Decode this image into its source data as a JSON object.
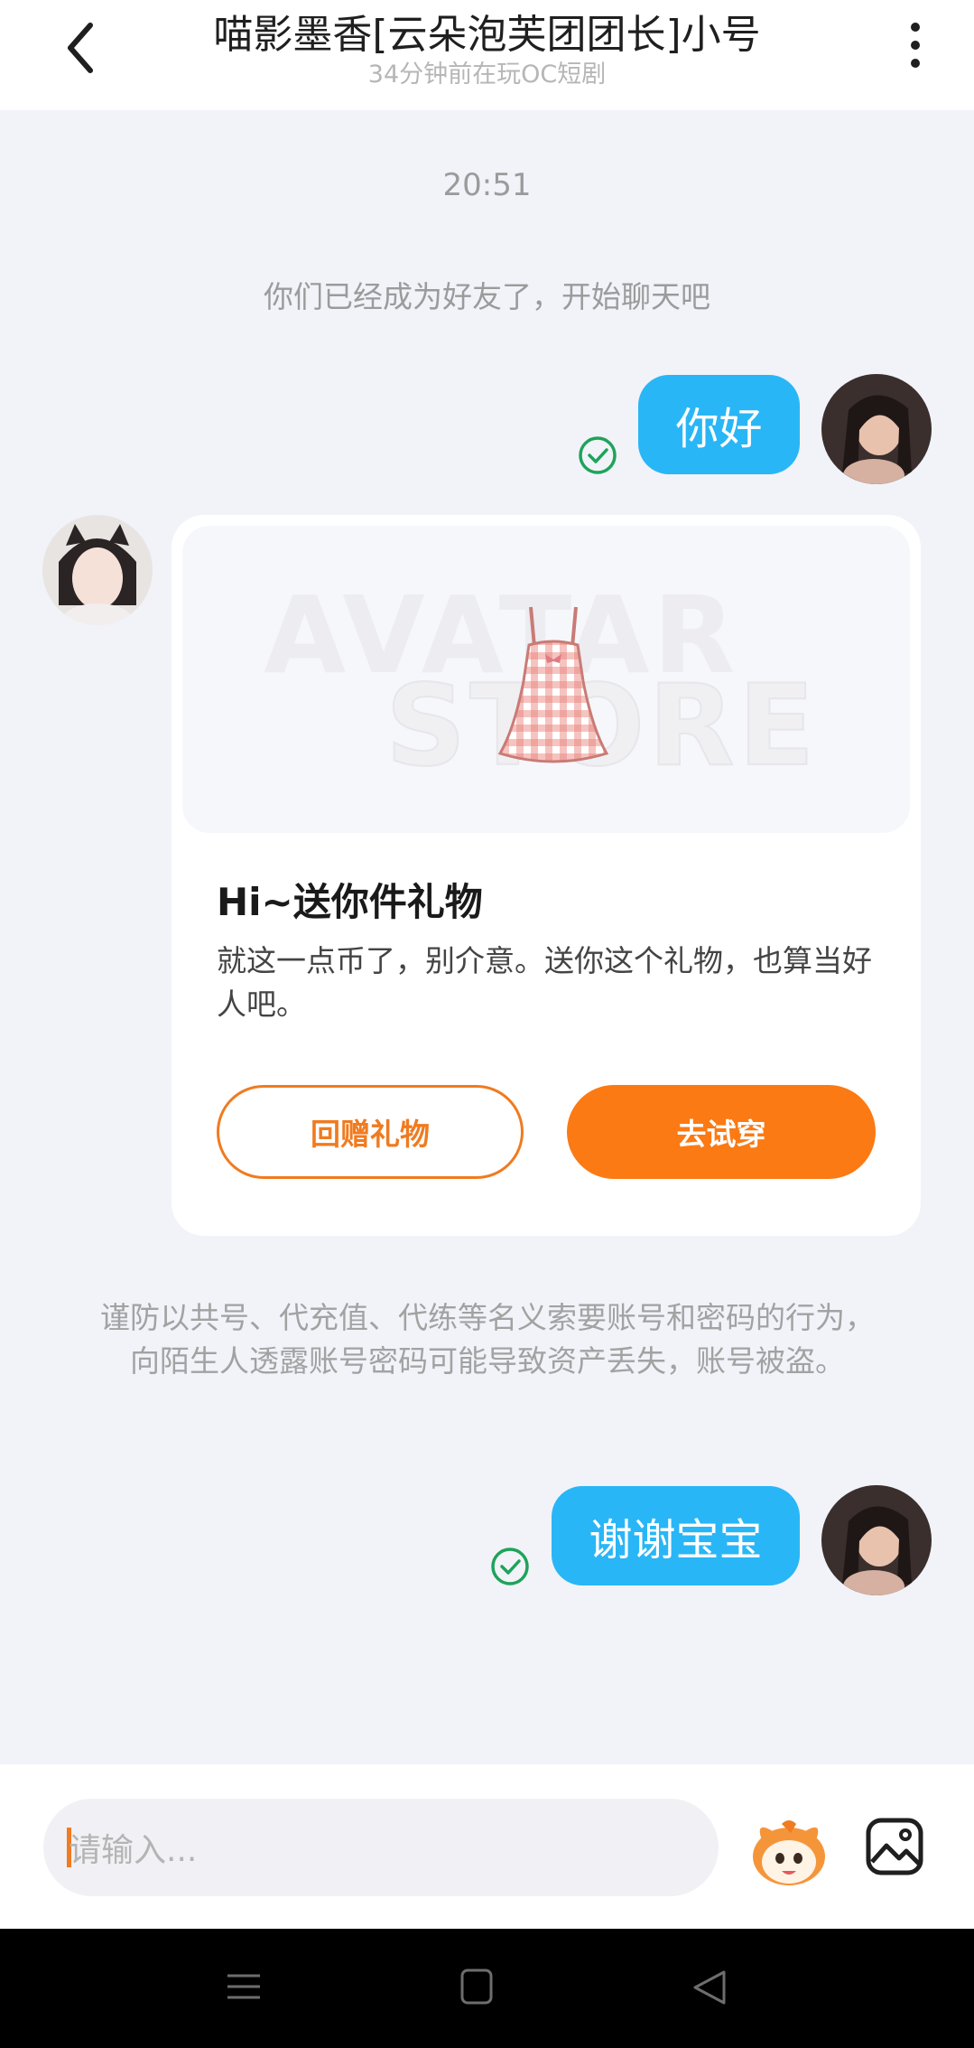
{
  "header": {
    "title": "喵影墨香[云朵泡芙团团长]小号",
    "subtitle": "34分钟前在玩OC短剧",
    "back_icon": "back-arrow-icon",
    "more_icon": "more-vertical-icon"
  },
  "chat": {
    "time": "20:51",
    "system_friend": "你们已经成为好友了，开始聊天吧",
    "msg1": "你好",
    "msg2": "谢谢宝宝",
    "gift": {
      "watermark_line1": "AVATAR",
      "watermark_line2": "STORE",
      "title": "Hi~送你件礼物",
      "description": "就这一点币了，别介意。送你这个礼物，也算当好人吧。",
      "return_button": "回赠礼物",
      "try_button": "去试穿"
    },
    "warning": "谨防以共号、代充值、代练等名义索要账号和密码的行为，向陌生人透露账号密码可能导致资产丢失，账号被盗。"
  },
  "input": {
    "placeholder": "请输入..."
  },
  "colors": {
    "accent_orange": "#fb7a14",
    "bubble_blue": "#29b6f6",
    "sent_check_green": "#1fa35a",
    "background": "#f1f3f9"
  }
}
